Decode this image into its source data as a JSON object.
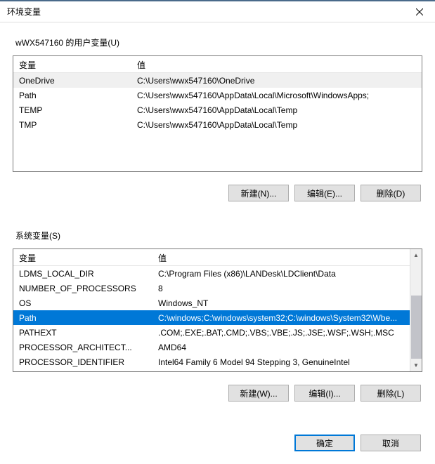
{
  "titlebar": {
    "title": "环境变量"
  },
  "user_section": {
    "label": "wWX547160 的用户变量(U)",
    "headers": {
      "name": "变量",
      "value": "值"
    },
    "rows": [
      {
        "name": "OneDrive",
        "value": "C:\\Users\\wwx547160\\OneDrive",
        "highlight": true
      },
      {
        "name": "Path",
        "value": "C:\\Users\\wwx547160\\AppData\\Local\\Microsoft\\WindowsApps;"
      },
      {
        "name": "TEMP",
        "value": "C:\\Users\\wwx547160\\AppData\\Local\\Temp"
      },
      {
        "name": "TMP",
        "value": "C:\\Users\\wwx547160\\AppData\\Local\\Temp"
      }
    ],
    "buttons": {
      "new": "新建(N)...",
      "edit": "编辑(E)...",
      "delete": "删除(D)"
    }
  },
  "system_section": {
    "label": "系统变量(S)",
    "headers": {
      "name": "变量",
      "value": "值"
    },
    "rows": [
      {
        "name": "LDMS_LOCAL_DIR",
        "value": "C:\\Program Files (x86)\\LANDesk\\LDClient\\Data"
      },
      {
        "name": "NUMBER_OF_PROCESSORS",
        "value": "8"
      },
      {
        "name": "OS",
        "value": "Windows_NT"
      },
      {
        "name": "Path",
        "value": "C:\\windows;C:\\windows\\system32;C:\\windows\\System32\\Wbe...",
        "selected": true
      },
      {
        "name": "PATHEXT",
        "value": ".COM;.EXE;.BAT;.CMD;.VBS;.VBE;.JS;.JSE;.WSF;.WSH;.MSC"
      },
      {
        "name": "PROCESSOR_ARCHITECT...",
        "value": "AMD64"
      },
      {
        "name": "PROCESSOR_IDENTIFIER",
        "value": "Intel64 Family 6 Model 94 Stepping 3, GenuineIntel"
      }
    ],
    "buttons": {
      "new": "新建(W)...",
      "edit": "编辑(I)...",
      "delete": "删除(L)"
    }
  },
  "footer": {
    "ok": "确定",
    "cancel": "取消"
  }
}
